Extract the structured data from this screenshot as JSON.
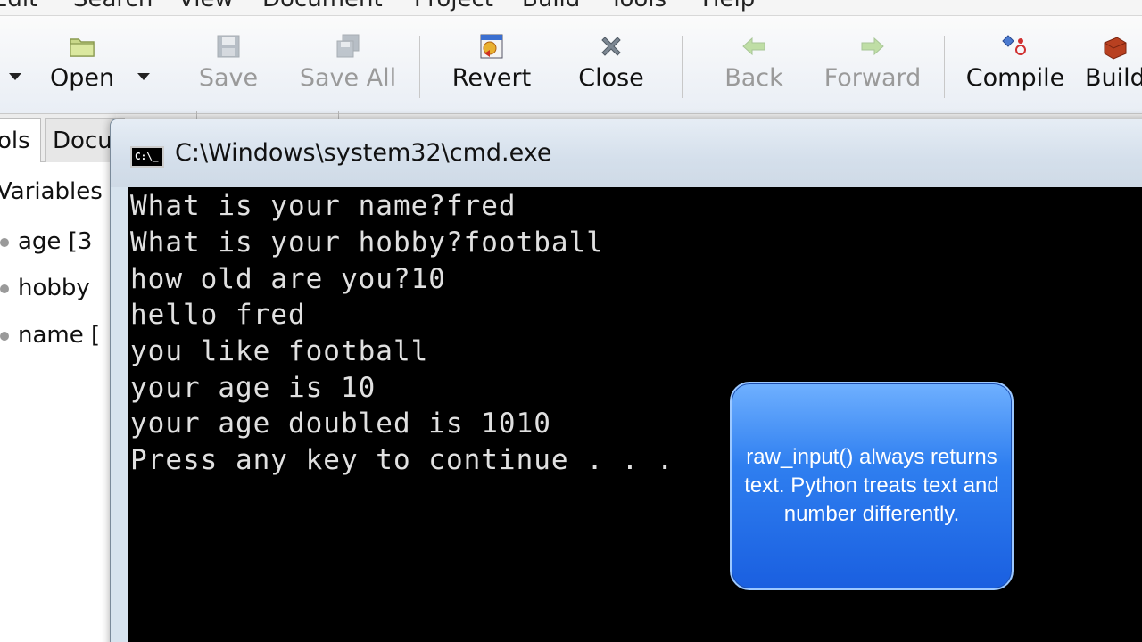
{
  "menu": {
    "items": [
      "Edit",
      "Search",
      "View",
      "Document",
      "Project",
      "Build",
      "Tools",
      "Help"
    ]
  },
  "toolbar": {
    "open": "Open",
    "save": "Save",
    "save_all": "Save All",
    "revert": "Revert",
    "close": "Close",
    "back": "Back",
    "forward": "Forward",
    "compile": "Compile",
    "build": "Build"
  },
  "sidebar": {
    "tabs": [
      "ols",
      "Docu"
    ],
    "section": "Variables",
    "items": [
      {
        "label": "age [3"
      },
      {
        "label": "hobby"
      },
      {
        "label": "name ["
      }
    ]
  },
  "cmd": {
    "title": "C:\\Windows\\system32\\cmd.exe",
    "icon_text": "C:\\_",
    "lines": [
      "What is your name?fred",
      "What is your hobby?football",
      "how old are you?10",
      "hello fred",
      "you like football",
      "your age is 10",
      "your age doubled is 1010",
      "Press any key to continue . . ."
    ]
  },
  "callout": {
    "text": "raw_input() always returns text. Python treats text and number differently."
  },
  "colors": {
    "callout_top": "#6fb0ff",
    "callout_bottom": "#1a5fe0",
    "console_bg": "#000000",
    "console_text": "#e0e0e0"
  }
}
